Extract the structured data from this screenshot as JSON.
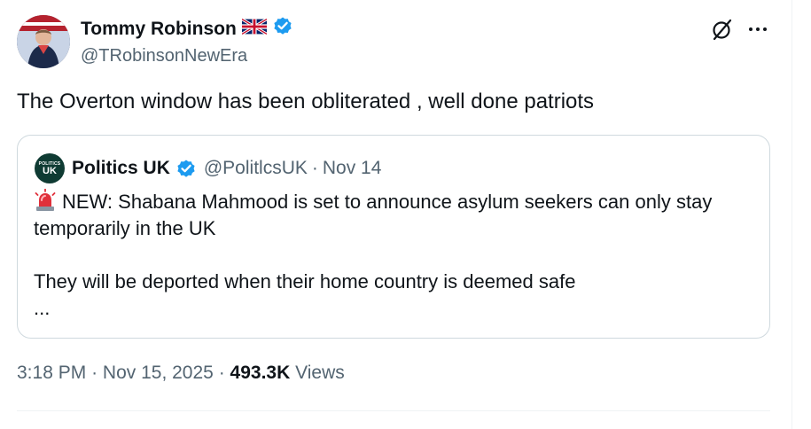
{
  "author": {
    "name": "Tommy Robinson",
    "flag_emoji": "flag-uk-icon",
    "verified_icon": "verified-badge-icon",
    "handle": "@TRobinsonNewEra"
  },
  "tweet": {
    "text": "The Overton window has been obliterated , well done patriots"
  },
  "quoted": {
    "avatar_small_text": "POLITICS",
    "avatar_big_text": "UK",
    "name": "Politics UK",
    "handle": "@PolitlcsUK",
    "separator": "·",
    "date": "Nov 14",
    "line1": "NEW: Shabana Mahmood is set to announce asylum seekers can only stay",
    "line2": "temporarily in the UK",
    "line3": "They will be deported when their home country is deemed safe",
    "line4": "...",
    "emoji_icon": "siren-icon"
  },
  "meta": {
    "time": "3:18 PM",
    "sep1": "·",
    "date": "Nov 15, 2025",
    "sep2": "·",
    "views_count": "493.3K",
    "views_label": "Views"
  },
  "colors": {
    "verified": "#1d9bf0",
    "secondary_text": "#536471",
    "border": "#cfd9de"
  },
  "icons": [
    "grok-icon",
    "more-icon"
  ]
}
